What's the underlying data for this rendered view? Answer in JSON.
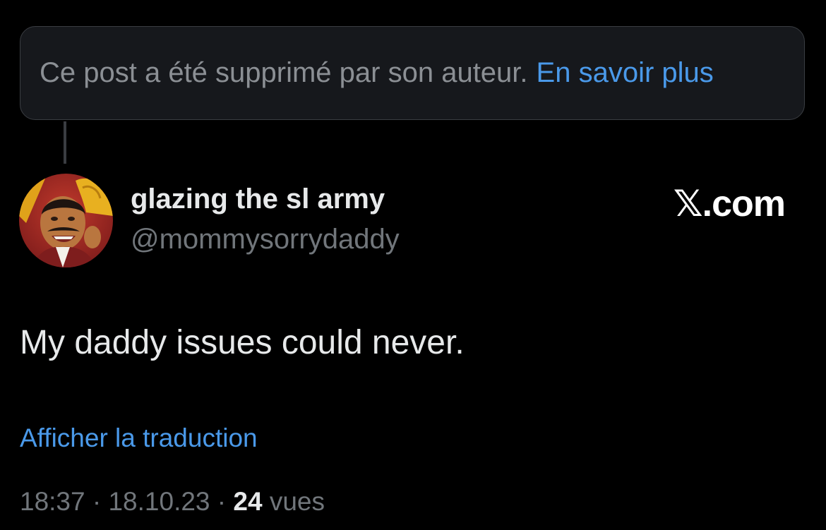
{
  "deleted_notice": {
    "text": "Ce post a été supprimé par son auteur.",
    "link": "En savoir plus"
  },
  "author": {
    "display_name": "glazing the sl army",
    "handle": "@mommysorrydaddy"
  },
  "watermark": "𝕏.com",
  "post": {
    "text": "My daddy issues could never."
  },
  "translate_link": "Afficher la traduction",
  "meta": {
    "time": "18:37",
    "date": "18.10.23",
    "separator": "·",
    "views_count": "24",
    "views_label": "vues"
  },
  "colors": {
    "background": "#000000",
    "link": "#4a99e9",
    "secondary_text": "#71767b",
    "primary_text": "#e7e9ea"
  }
}
